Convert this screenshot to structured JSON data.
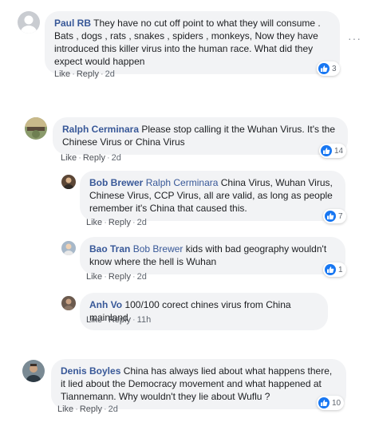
{
  "comments": [
    {
      "author": "Paul RB",
      "mention": "",
      "text": "They have no cut off point to what they will consume . Bats , dogs , rats , snakes , spiders , monkeys, Now they have introduced this killer virus into the human race. What did they expect would happen",
      "like": "Like",
      "reply": "Reply",
      "time": "2d",
      "reactions": "3"
    },
    {
      "author": "Ralph Cerminara",
      "mention": "",
      "text": "Please stop calling it the Wuhan Virus. It's the Chinese Virus or China Virus",
      "like": "Like",
      "reply": "Reply",
      "time": "2d",
      "reactions": "14"
    },
    {
      "author": "Bob Brewer",
      "mention": "Ralph Cerminara",
      "text": "China Virus, Wuhan Virus, Chinese Virus, CCP Virus, all are valid, as long as people remember it's China that caused this.",
      "like": "Like",
      "reply": "Reply",
      "time": "2d",
      "reactions": "7"
    },
    {
      "author": "Bao Tran",
      "mention": "Bob Brewer",
      "text": "kids with bad geography wouldn't know where the hell is Wuhan",
      "like": "Like",
      "reply": "Reply",
      "time": "2d",
      "reactions": "1"
    },
    {
      "author": "Anh Vo",
      "mention": "",
      "text": "100/100 corect chines virus from China mainland",
      "like": "Like",
      "reply": "Reply",
      "time": "11h",
      "reactions": ""
    },
    {
      "author": "Denis Boyles",
      "mention": "",
      "text": "China has always lied about what happens there, it lied about the Democracy movement and what happened at Tiannemann. Why wouldn't they lie about Wuflu ?",
      "like": "Like",
      "reply": "Reply",
      "time": "2d",
      "reactions": "10"
    }
  ],
  "more_options": "···",
  "colors": {
    "link": "#385898",
    "bubble": "#f2f3f5",
    "like_blue": "#1877f2"
  },
  "icons": {
    "like": "thumbs-up-icon",
    "more": "more-options-icon"
  }
}
